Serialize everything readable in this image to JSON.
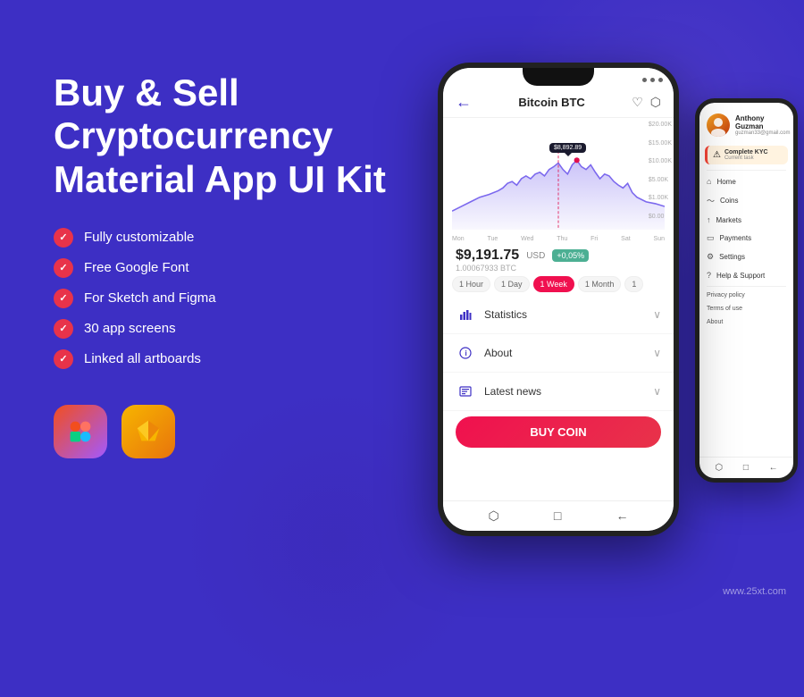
{
  "background": {
    "color": "#3d2fc4"
  },
  "left_panel": {
    "title": "Buy & Sell\nCryptocurrency\nMaterial App UI Kit",
    "features": [
      "Fully customizable",
      "Free Google Font",
      "For Sketch and Figma",
      "30 app screens",
      "Linked all artboards"
    ],
    "tools": [
      {
        "name": "Figma",
        "icon": "figma-icon"
      },
      {
        "name": "Sketch",
        "icon": "sketch-icon"
      }
    ]
  },
  "phone_main": {
    "header": {
      "back": "←",
      "title": "Bitcoin BTC",
      "heart": "♡",
      "share": "⬡"
    },
    "chart": {
      "tooltip": "$8,892.89",
      "y_labels": [
        "$20.00K",
        "$15.00K",
        "$10.00K",
        "$5.00K",
        "$1.00K",
        "$0.00"
      ],
      "x_labels": [
        "Mon",
        "Tue",
        "Wed",
        "Thu",
        "Fri",
        "Sat",
        "Sun"
      ]
    },
    "price": {
      "value": "$9,191.75",
      "currency": "USD",
      "change": "+0,05%",
      "btc": "1.00067933 BTC"
    },
    "time_filters": [
      "1 Hour",
      "1 Day",
      "1 Week",
      "1 Month",
      "1"
    ],
    "sections": [
      {
        "icon": "📊",
        "label": "Statistics"
      },
      {
        "icon": "ℹ",
        "label": "About"
      },
      {
        "icon": "📰",
        "label": "Latest news"
      }
    ],
    "buy_button": "BUY COIN",
    "nav": [
      "⬡",
      "□",
      "←"
    ]
  },
  "phone_side": {
    "user": {
      "name": "Anthony Guzman",
      "email": "guzman33@gmail.com"
    },
    "kyc": {
      "title": "Complete KYC",
      "subtitle": "Current task"
    },
    "nav_items": [
      {
        "icon": "⌂",
        "label": "Home"
      },
      {
        "icon": "~",
        "label": "Coins"
      },
      {
        "icon": "↑",
        "label": "Markets"
      },
      {
        "icon": "💳",
        "label": "Payments"
      },
      {
        "icon": "⚙",
        "label": "Settings"
      },
      {
        "icon": "?",
        "label": "Help & Support"
      }
    ],
    "text_items": [
      "Privacy policy",
      "Terms of use",
      "About"
    ],
    "nav_bottom": [
      "⬡",
      "□",
      "←"
    ]
  },
  "watermark": "www.25xt.com"
}
